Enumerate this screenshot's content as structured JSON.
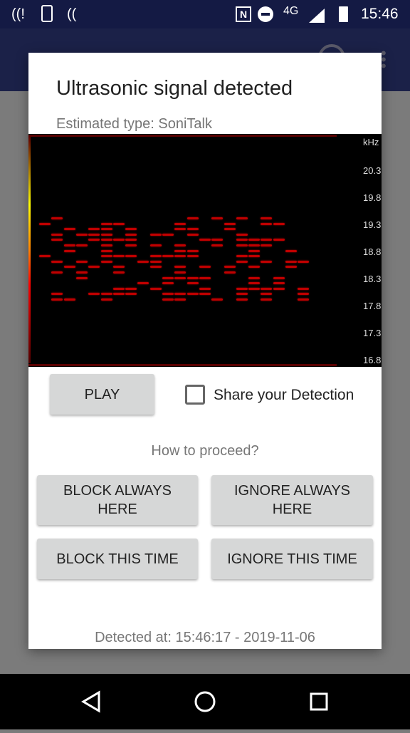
{
  "status_bar": {
    "time": "15:46",
    "network": "4G",
    "icons": [
      "hearing-alert-icon",
      "screen-rotation-icon",
      "hearing-icon",
      "nfc-icon",
      "do-not-disturb-icon",
      "signal-icon",
      "battery-icon"
    ]
  },
  "dialog": {
    "title": "Ultrasonic signal detected",
    "subtitle": "Estimated type: SoniTalk",
    "spectrogram": {
      "unit": "kHz",
      "ticks": [
        "20.3",
        "19.8",
        "19.3",
        "18.8",
        "18.3",
        "17.8",
        "17.3",
        "16.8"
      ],
      "signal_color": "#c00000"
    },
    "play_label": "PLAY",
    "share_label": "Share your Detection",
    "share_checked": false,
    "prompt": "How to proceed?",
    "block_always": "BLOCK ALWAYS HERE",
    "ignore_always": "IGNORE ALWAYS HERE",
    "block_once": "BLOCK THIS TIME",
    "ignore_once": "IGNORE THIS TIME",
    "detected_at": "Detected at:  15:46:17 - 2019-11-06"
  }
}
